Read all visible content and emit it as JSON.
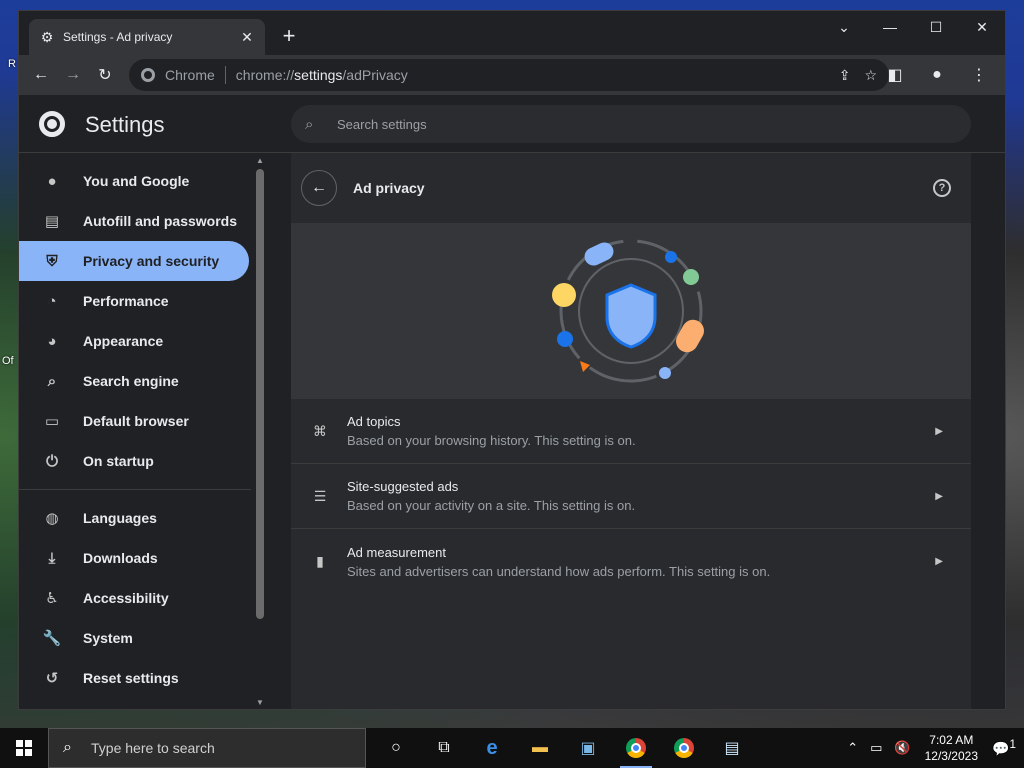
{
  "desktop": {
    "label_top": "R",
    "label_mid": "Of"
  },
  "tab": {
    "icon": "gear-icon",
    "title": "Settings - Ad privacy",
    "close": "✕"
  },
  "new_tab": "+",
  "window_controls": {
    "dropdown": "⌄",
    "minimize": "—",
    "maximize": "☐",
    "close": "✕"
  },
  "toolbar": {
    "back": "←",
    "forward": "→",
    "reload": "↻",
    "site_label": "Chrome",
    "url_prefix": "chrome://",
    "url_main": "settings",
    "url_suffix": "/adPrivacy",
    "share": "⇪",
    "bookmark": "☆",
    "sidepanel": "◧",
    "profile": "●",
    "menu": "⋮"
  },
  "settings": {
    "title": "Settings",
    "search_placeholder": "Search settings",
    "nav": [
      {
        "label": "You and Google",
        "icon": "person-icon",
        "glyph": "●"
      },
      {
        "label": "Autofill and passwords",
        "icon": "clipboard-icon",
        "glyph": "▤"
      },
      {
        "label": "Privacy and security",
        "icon": "shield-icon",
        "glyph": "⛨",
        "active": true
      },
      {
        "label": "Performance",
        "icon": "speedometer-icon",
        "glyph": "◔"
      },
      {
        "label": "Appearance",
        "icon": "palette-icon",
        "glyph": "◕"
      },
      {
        "label": "Search engine",
        "icon": "search-icon",
        "glyph": "⌕"
      },
      {
        "label": "Default browser",
        "icon": "browser-icon",
        "glyph": "▭"
      },
      {
        "label": "On startup",
        "icon": "power-icon",
        "glyph": "⏻"
      }
    ],
    "nav2": [
      {
        "label": "Languages",
        "icon": "globe-icon",
        "glyph": "◍"
      },
      {
        "label": "Downloads",
        "icon": "download-icon",
        "glyph": "⤓"
      },
      {
        "label": "Accessibility",
        "icon": "accessibility-icon",
        "glyph": "♿"
      },
      {
        "label": "System",
        "icon": "wrench-icon",
        "glyph": "🔧"
      },
      {
        "label": "Reset settings",
        "icon": "history-icon",
        "glyph": "↺"
      }
    ]
  },
  "main": {
    "title": "Ad privacy",
    "help": "?",
    "rows": [
      {
        "title": "Ad topics",
        "subtitle": "Based on your browsing history. This setting is on.",
        "icon": "topics-icon",
        "glyph": "⌘"
      },
      {
        "title": "Site-suggested ads",
        "subtitle": "Based on your activity on a site. This setting is on.",
        "icon": "checklist-icon",
        "glyph": "☰"
      },
      {
        "title": "Ad measurement",
        "subtitle": "Sites and advertisers can understand how ads perform. This setting is on.",
        "icon": "bar-chart-icon",
        "glyph": "▮"
      }
    ],
    "colors": {
      "shield": "#8ab4f8",
      "yellow": "#fdd663",
      "green": "#81c995",
      "peach": "#fcad70",
      "blue": "#1a73e8",
      "orange": "#fa7b17"
    }
  },
  "taskbar": {
    "search_placeholder": "Type here to search",
    "time": "7:02 AM",
    "date": "12/3/2023",
    "notification_count": "1"
  }
}
